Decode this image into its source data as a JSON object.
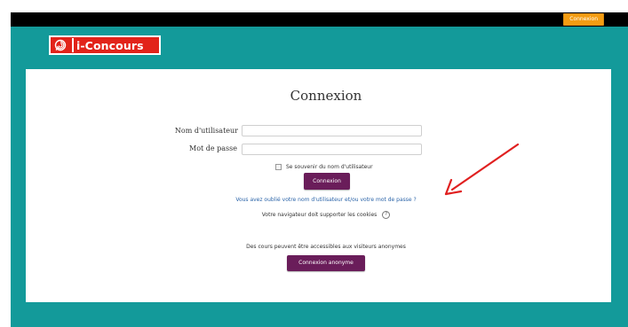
{
  "topbar": {
    "login_label": "Connexion"
  },
  "header": {
    "logo_text": "i-Concours"
  },
  "login": {
    "title": "Connexion",
    "username_label": "Nom d'utilisateur",
    "username_value": "",
    "password_label": "Mot de passe",
    "password_value": "",
    "remember_label": "Se souvenir du nom d'utilisateur",
    "submit_label": "Connexion",
    "forgot_link": "Vous avez oublié votre nom d'utilisateur et/ou votre mot de passe ?",
    "cookies_note": "Votre navigateur doit supporter les cookies",
    "cookie_help_icon": "?"
  },
  "guest": {
    "note": "Des cours peuvent être accessibles aux visiteurs anonymes",
    "button_label": "Connexion anonyme"
  },
  "colors": {
    "teal": "#139a9a",
    "orange": "#f39c12",
    "purple": "#6a1d5a",
    "logo_red": "#e2231a",
    "arrow_red": "#e02020",
    "link_blue": "#2a63a8"
  }
}
